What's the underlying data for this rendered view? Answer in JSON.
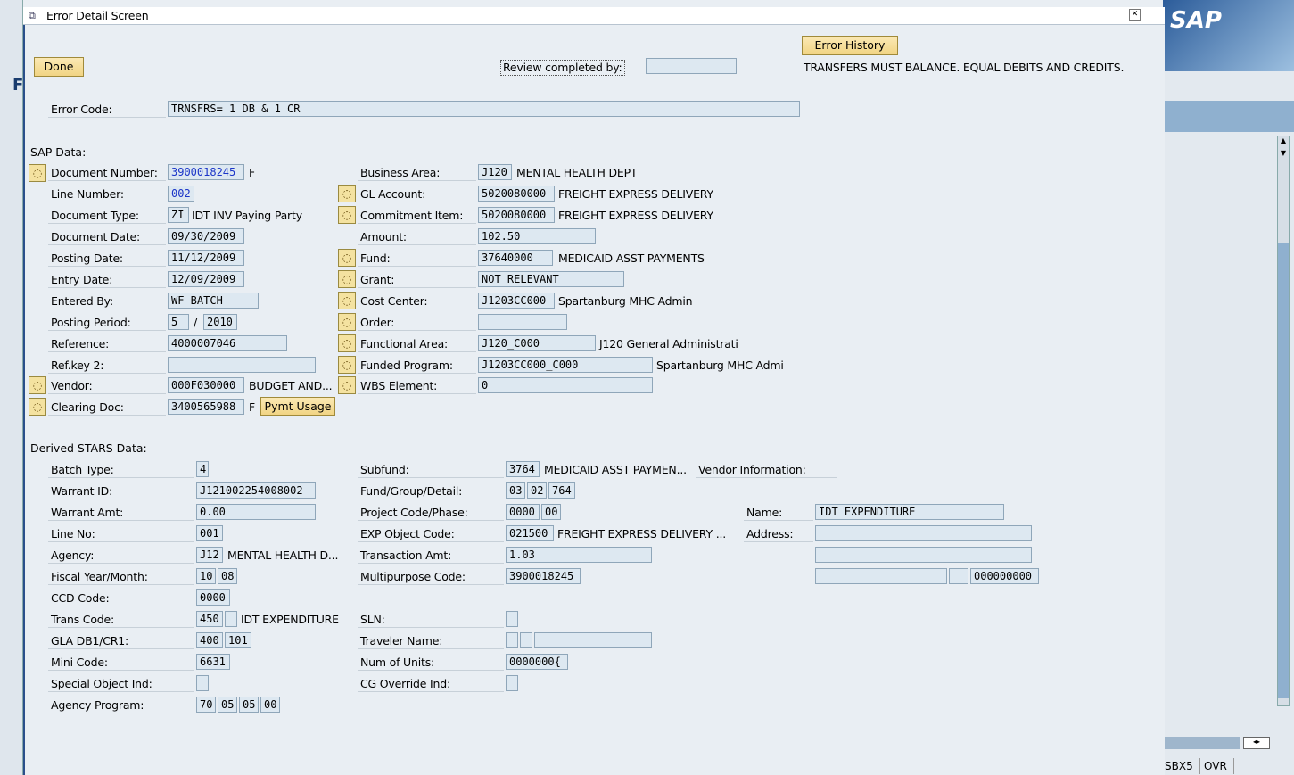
{
  "dialog": {
    "title": "Error Detail Screen",
    "buttons": {
      "done": "Done",
      "error_history": "Error History",
      "pymt_usage": "Pymt Usage"
    },
    "review_label": "Review completed by:",
    "review_value": "",
    "message": "TRANSFERS MUST BALANCE. EQUAL DEBITS AND CREDITS.",
    "error_code_label": "Error Code:",
    "error_code_value": "TRNSFRS= 1 DB & 1 CR"
  },
  "sap": {
    "heading": "SAP Data:",
    "document_number": {
      "label": "Document Number:",
      "value": "3900018245",
      "suffix": "F"
    },
    "line_number": {
      "label": "Line Number:",
      "value": "002"
    },
    "document_type": {
      "label": "Document Type:",
      "value": "ZI",
      "text": "IDT INV Paying Party"
    },
    "document_date": {
      "label": "Document Date:",
      "value": "09/30/2009"
    },
    "posting_date": {
      "label": "Posting Date:",
      "value": "11/12/2009"
    },
    "entry_date": {
      "label": "Entry Date:",
      "value": "12/09/2009"
    },
    "entered_by": {
      "label": "Entered By:",
      "value": "WF-BATCH"
    },
    "posting_period": {
      "label": "Posting Period:",
      "value": "5",
      "sep": "/",
      "year": "2010"
    },
    "reference": {
      "label": "Reference:",
      "value": "4000007046"
    },
    "ref_key2": {
      "label": "Ref.key 2:",
      "value": ""
    },
    "vendor": {
      "label": "Vendor:",
      "value": "000F030000",
      "text": "BUDGET AND..."
    },
    "clearing_doc": {
      "label": "Clearing Doc:",
      "value": "3400565988",
      "suffix": "F"
    },
    "business_area": {
      "label": "Business Area:",
      "value": "J120",
      "text": "MENTAL HEALTH DEPT"
    },
    "gl_account": {
      "label": "GL Account:",
      "value": "5020080000",
      "text": "FREIGHT EXPRESS DELIVERY"
    },
    "commitment_item": {
      "label": "Commitment Item:",
      "value": "5020080000",
      "text": "FREIGHT EXPRESS DELIVERY"
    },
    "amount": {
      "label": "Amount:",
      "value": "102.50"
    },
    "fund": {
      "label": "Fund:",
      "value": "37640000",
      "text": "MEDICAID ASST PAYMENTS"
    },
    "grant": {
      "label": "Grant:",
      "value": "NOT RELEVANT"
    },
    "cost_center": {
      "label": "Cost Center:",
      "value": "J1203CC000",
      "text": "Spartanburg MHC Admin"
    },
    "order": {
      "label": "Order:",
      "value": ""
    },
    "functional_area": {
      "label": "Functional Area:",
      "value": "J120_C000",
      "text": "J120 General Administrati"
    },
    "funded_program": {
      "label": "Funded Program:",
      "value": "J1203CC000_C000",
      "text": "Spartanburg MHC Admi"
    },
    "wbs_element": {
      "label": "WBS Element:",
      "value": "0"
    }
  },
  "stars": {
    "heading": "Derived STARS Data:",
    "batch_type": {
      "label": "Batch Type:",
      "value": "4"
    },
    "warrant_id": {
      "label": "Warrant ID:",
      "value": "J121002254008002"
    },
    "warrant_amt": {
      "label": "Warrant Amt:",
      "value": "0.00"
    },
    "line_no": {
      "label": "Line No:",
      "value": "001"
    },
    "agency": {
      "label": "Agency:",
      "value": "J12",
      "text": "MENTAL HEALTH D..."
    },
    "fiscal": {
      "label": "Fiscal Year/Month:",
      "year": "10",
      "month": "08"
    },
    "ccd_code": {
      "label": "CCD Code:",
      "value": "0000"
    },
    "trans_code": {
      "label": "Trans Code:",
      "value": "450",
      "value2": "",
      "text": "IDT EXPENDITURE"
    },
    "gla": {
      "label": "GLA DB1/CR1:",
      "db": "400",
      "cr": "101"
    },
    "mini_code": {
      "label": "Mini Code:",
      "value": "6631"
    },
    "special_object": {
      "label": "Special Object Ind:",
      "value": ""
    },
    "agency_program": {
      "label": "Agency Program:",
      "values": [
        "70",
        "05",
        "05",
        "00"
      ]
    },
    "subfund": {
      "label": "Subfund:",
      "value": "3764",
      "text": "MEDICAID ASST PAYMEN..."
    },
    "fund_group": {
      "label": "Fund/Group/Detail:",
      "values": [
        "03",
        "02",
        "764"
      ]
    },
    "project_code": {
      "label": "Project Code/Phase:",
      "code": "0000",
      "phase": "00"
    },
    "exp_object": {
      "label": "EXP Object Code:",
      "value": "021500",
      "text": "FREIGHT EXPRESS DELIVERY ..."
    },
    "transaction_amt": {
      "label": "Transaction Amt:",
      "value": "1.03"
    },
    "multipurpose": {
      "label": "Multipurpose Code:",
      "value": "3900018245"
    },
    "sln": {
      "label": "SLN:",
      "value": ""
    },
    "traveler_name": {
      "label": "Traveler Name:"
    },
    "num_units": {
      "label": "Num of Units:",
      "value": "0000000{"
    },
    "cg_override": {
      "label": "CG Override Ind:",
      "value": ""
    }
  },
  "vendor_info": {
    "heading": "Vendor Information:",
    "name_label": "Name:",
    "name_value": "IDT EXPENDITURE",
    "address_label": "Address:",
    "zip_value": "000000000"
  },
  "statusbar": {
    "system": "SBX5",
    "mode": "OVR"
  },
  "brand": "SAP"
}
